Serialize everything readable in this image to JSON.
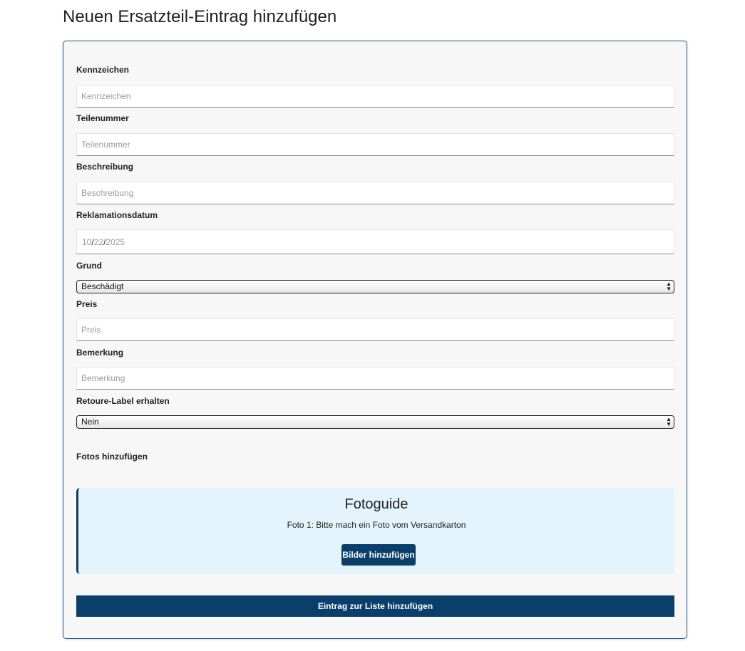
{
  "page": {
    "title": "Neuen Ersatzteil-Eintrag hinzufügen"
  },
  "form": {
    "kennzeichen": {
      "label": "Kennzeichen",
      "placeholder": "Kennzeichen",
      "value": ""
    },
    "teilenummer": {
      "label": "Teilenummer",
      "placeholder": "Teilenummer",
      "value": ""
    },
    "beschreibung": {
      "label": "Beschreibung",
      "placeholder": "Beschreibung",
      "value": ""
    },
    "reklamationsdatum": {
      "label": "Reklamationsdatum",
      "month": "10",
      "day": "22",
      "year": "2025",
      "separator": "/"
    },
    "grund": {
      "label": "Grund",
      "selected": "Beschädigt"
    },
    "preis": {
      "label": "Preis",
      "placeholder": "Preis",
      "value": ""
    },
    "bemerkung": {
      "label": "Bemerkung",
      "placeholder": "Bemerkung",
      "value": ""
    },
    "retoure_label": {
      "label": "Retoure-Label erhalten",
      "selected": "Nein"
    },
    "fotos": {
      "label": "Fotos hinzufügen"
    }
  },
  "fotoguide": {
    "title": "Fotoguide",
    "instruction": "Foto 1: Bitte mach ein Foto vom Versandkarton",
    "button_label": "Bilder hinzufügen"
  },
  "submit": {
    "label": "Eintrag zur Liste hinzufügen"
  },
  "colors": {
    "primary": "#0b3f6b",
    "card_border": "#1f5c8b",
    "card_background": "#f7f7f7",
    "guide_background": "#e4f4fc"
  },
  "icons": {
    "select_arrows": "up-down-chevron-icon"
  }
}
